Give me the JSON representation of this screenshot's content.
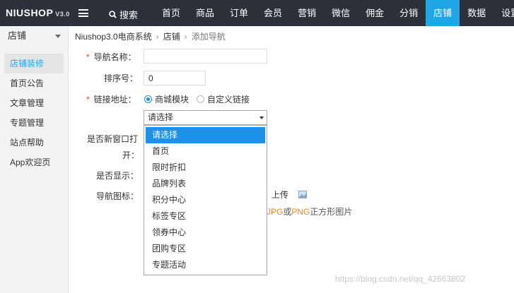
{
  "logo": {
    "brand": "NIUSHOP",
    "version": "V3.0"
  },
  "topbar": {
    "search_label": "搜索",
    "nav": [
      {
        "label": "首页",
        "active": false
      },
      {
        "label": "商品",
        "active": false
      },
      {
        "label": "订单",
        "active": false
      },
      {
        "label": "会员",
        "active": false
      },
      {
        "label": "营销",
        "active": false
      },
      {
        "label": "微信",
        "active": false
      },
      {
        "label": "佣金",
        "active": false
      },
      {
        "label": "分销",
        "active": false
      },
      {
        "label": "店铺",
        "active": true
      },
      {
        "label": "数据",
        "active": false
      },
      {
        "label": "设置",
        "active": false
      }
    ]
  },
  "sidebar": {
    "header": "店铺",
    "items": [
      {
        "label": "店铺装修",
        "active": true
      },
      {
        "label": "首页公告",
        "active": false
      },
      {
        "label": "文章管理",
        "active": false
      },
      {
        "label": "专题管理",
        "active": false
      },
      {
        "label": "站点帮助",
        "active": false
      },
      {
        "label": "App欢迎页",
        "active": false
      }
    ]
  },
  "breadcrumb": {
    "root": "Niushop3.0电商系统",
    "section": "店铺",
    "current": "添加导航",
    "separator": "›"
  },
  "form": {
    "required_mark": "*",
    "nav_name_label": "导航名称：",
    "nav_name_value": "",
    "sort_label": "排序号：",
    "sort_value": "0",
    "link_label": "链接地址：",
    "link_options": [
      {
        "label": "商城模块",
        "checked": true
      },
      {
        "label": "自定义链接",
        "checked": false
      }
    ],
    "select_value": "请选择",
    "new_window_label_line1": "是否新窗口打",
    "new_window_label_line2": "开：",
    "show_label": "是否显示：",
    "icon_label": "导航图标：",
    "upload_label": "上传",
    "hint_jpg": "JPG",
    "hint_or": "或",
    "hint_png": "PNG",
    "hint_rest": "正方形图片"
  },
  "dropdown": {
    "options": [
      {
        "label": "请选择",
        "selected": true
      },
      {
        "label": "首页",
        "selected": false
      },
      {
        "label": "限时折扣",
        "selected": false
      },
      {
        "label": "品牌列表",
        "selected": false
      },
      {
        "label": "积分中心",
        "selected": false
      },
      {
        "label": "标签专区",
        "selected": false
      },
      {
        "label": "领券中心",
        "selected": false
      },
      {
        "label": "团购专区",
        "selected": false
      },
      {
        "label": "专题活动",
        "selected": false
      }
    ]
  },
  "watermark": "https://blog.csdn.net/qq_42663802",
  "colors": {
    "topbar": "#2d2f3a",
    "accent": "#1fa6e6",
    "highlight": "#f0861e",
    "required": "#e53c3c"
  }
}
